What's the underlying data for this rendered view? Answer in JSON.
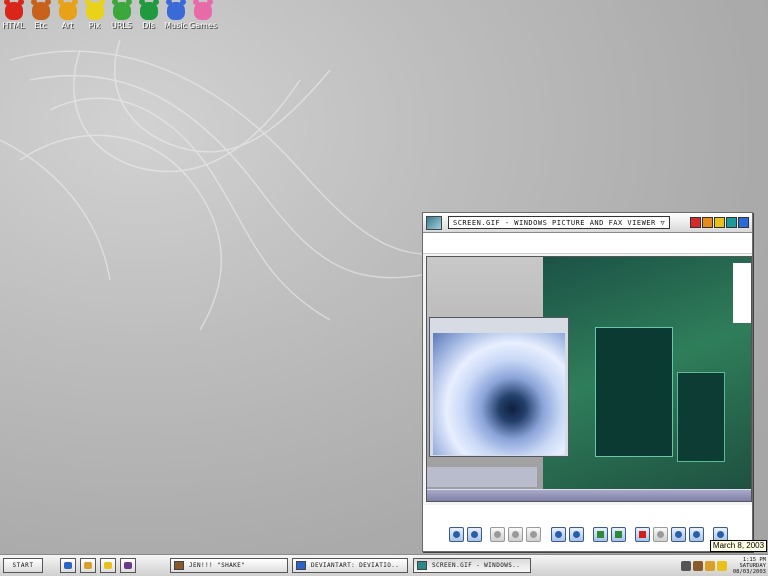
{
  "desktop": {
    "icons": [
      {
        "label": "HTML",
        "icon": "red-bug-icon",
        "color": "#d8261a"
      },
      {
        "label": "Etc",
        "icon": "mushroom-icon",
        "color": "#c8621a"
      },
      {
        "label": "Art",
        "icon": "crown-creature-icon",
        "color": "#e8a21a"
      },
      {
        "label": "Pix",
        "icon": "yellow-creature-icon",
        "color": "#e8d21a"
      },
      {
        "label": "URLS",
        "icon": "green-invader-icon",
        "color": "#3aa83a"
      },
      {
        "label": "DIs",
        "icon": "green-frog-icon",
        "color": "#1f9a3f"
      },
      {
        "label": "Music",
        "icon": "blue-creature-icon",
        "color": "#3a6ad8"
      },
      {
        "label": "Games",
        "icon": "pink-pig-icon",
        "color": "#e86aa8"
      }
    ]
  },
  "viewer": {
    "title": "SCREEN.GIF - WINDOWS PICTURE AND FAX VIEWER",
    "title_dropdown": "▽",
    "window_buttons": [
      {
        "name": "red",
        "color": "#d52a2a"
      },
      {
        "name": "orange",
        "color": "#e88a1a"
      },
      {
        "name": "yellow",
        "color": "#e8c21a"
      },
      {
        "name": "teal",
        "color": "#1a9a9a"
      },
      {
        "name": "blue",
        "color": "#2a6ad8"
      }
    ],
    "toolbar": [
      "previous-image",
      "next-image",
      "best-fit",
      "actual-size",
      "slideshow",
      "zoom-in",
      "zoom-out",
      "rotate-clockwise",
      "rotate-counterclockwise",
      "delete",
      "print",
      "copy-to",
      "edit",
      "help"
    ]
  },
  "taskbar": {
    "start_label": "START",
    "quick_launch": [
      {
        "icon": "internet-explorer-icon",
        "color": "#2a64c8"
      },
      {
        "icon": "outlook-express-icon",
        "color": "#d8a02a"
      },
      {
        "icon": "pencil-icon",
        "color": "#e8c21a"
      },
      {
        "icon": "media-icon",
        "color": "#6a3a8a"
      }
    ],
    "tasks": [
      {
        "label": "JEN!!! \"SHAKE\"",
        "color": "#8a5a2a",
        "active": false
      },
      {
        "label": "DEVIANTART: DEVIATIO..",
        "color": "#2a64c8",
        "active": false
      },
      {
        "label": "SCREEN.GIF - WINDOWS..",
        "color": "#2a8a8a",
        "active": true
      }
    ],
    "tray_icons": [
      {
        "icon": "monitor-icon",
        "color": "#555555"
      },
      {
        "icon": "network-icon",
        "color": "#8a5a2a"
      },
      {
        "icon": "shield-icon",
        "color": "#d8a02a"
      },
      {
        "icon": "alert-icon",
        "color": "#e8c21a"
      }
    ],
    "clock": {
      "time": "1:15 PM",
      "day": "SATURDAY",
      "date": "08/03/2003"
    },
    "tooltip": "March 8, 2003"
  }
}
